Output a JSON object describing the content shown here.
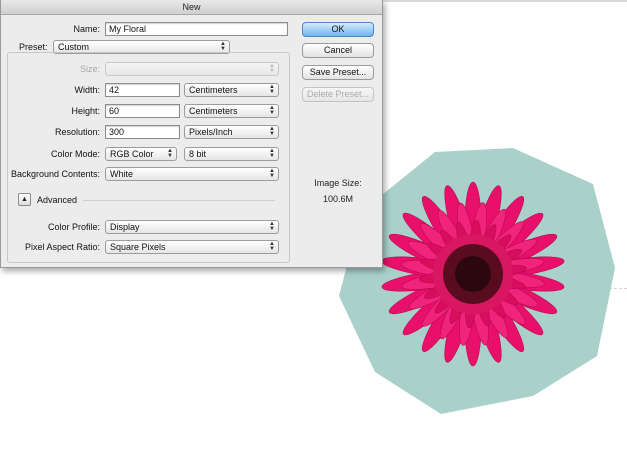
{
  "dialog": {
    "title": "New",
    "name": {
      "label": "Name:",
      "value": "My Floral"
    },
    "preset": {
      "label": "Preset:",
      "value": "Custom"
    },
    "size": {
      "label": "Size:",
      "value": ""
    },
    "width": {
      "label": "Width:",
      "value": "42",
      "unit": "Centimeters"
    },
    "height": {
      "label": "Height:",
      "value": "60",
      "unit": "Centimeters"
    },
    "resolution": {
      "label": "Resolution:",
      "value": "300",
      "unit": "Pixels/Inch"
    },
    "color_mode": {
      "label": "Color Mode:",
      "value": "RGB Color",
      "depth": "8 bit"
    },
    "background_contents": {
      "label": "Background Contents:",
      "value": "White"
    },
    "advanced": {
      "label": "Advanced",
      "toggle_glyph": "▲"
    },
    "color_profile": {
      "label": "Color Profile:",
      "value": "Display"
    },
    "pixel_aspect_ratio": {
      "label": "Pixel Aspect Ratio:",
      "value": "Square Pixels"
    },
    "buttons": {
      "ok": "OK",
      "cancel": "Cancel",
      "save_preset": "Save Preset...",
      "delete_preset": "Delete Preset..."
    },
    "image_size": {
      "label": "Image Size:",
      "value": "100.6M"
    }
  },
  "icons": {
    "select_arrows": "updown-arrows-icon"
  },
  "colors": {
    "ok_button": "#6fb6ee",
    "flower_petal": "#e8106a",
    "flower_center": "#3a0a14",
    "flower_background": "#a9d1c9"
  }
}
